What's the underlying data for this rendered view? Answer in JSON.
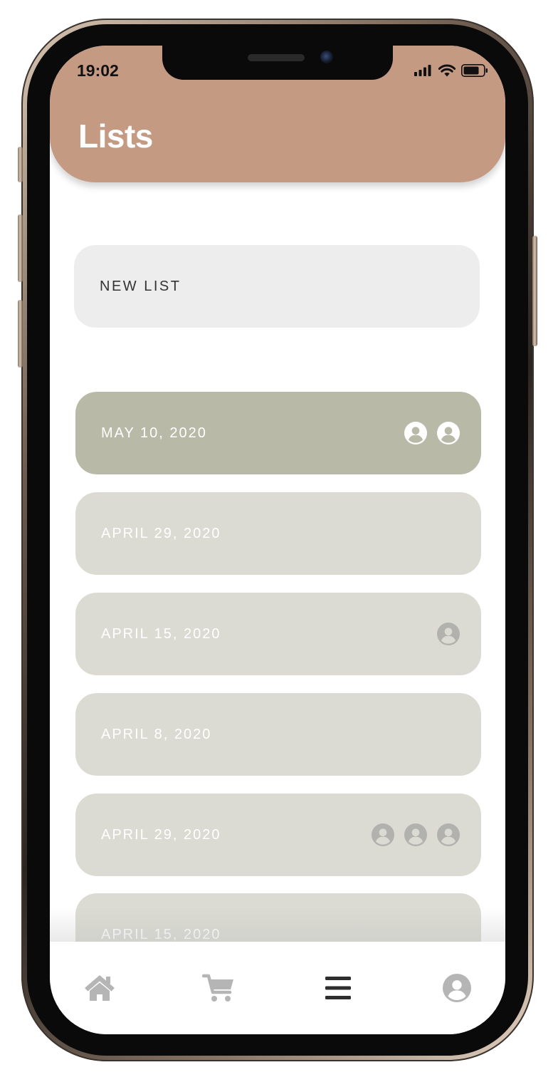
{
  "status_bar": {
    "time": "19:02"
  },
  "header": {
    "title": "Lists"
  },
  "new_list": {
    "label": "NEW LIST"
  },
  "lists": [
    {
      "date": "MAY 10, 2020",
      "members": 2,
      "active": true
    },
    {
      "date": "APRIL 29, 2020",
      "members": 0,
      "active": false
    },
    {
      "date": "APRIL 15, 2020",
      "members": 1,
      "active": false
    },
    {
      "date": "APRIL 8, 2020",
      "members": 0,
      "active": false
    },
    {
      "date": "APRIL 29, 2020",
      "members": 3,
      "active": false
    },
    {
      "date": "APRIL 15, 2020",
      "members": 0,
      "active": false
    }
  ],
  "tabbar": {
    "items": [
      {
        "icon": "home-icon",
        "active": false
      },
      {
        "icon": "cart-icon",
        "active": false
      },
      {
        "icon": "menu-icon",
        "active": true
      },
      {
        "icon": "profile-icon",
        "active": false
      }
    ]
  },
  "colors": {
    "header": "#c59a83",
    "active_card": "#b8baa7",
    "card": "#dbdbd3",
    "new_list_bg": "#ededed",
    "icon_inactive": "#b5b5b5",
    "icon_active": "#2e2e2e"
  }
}
